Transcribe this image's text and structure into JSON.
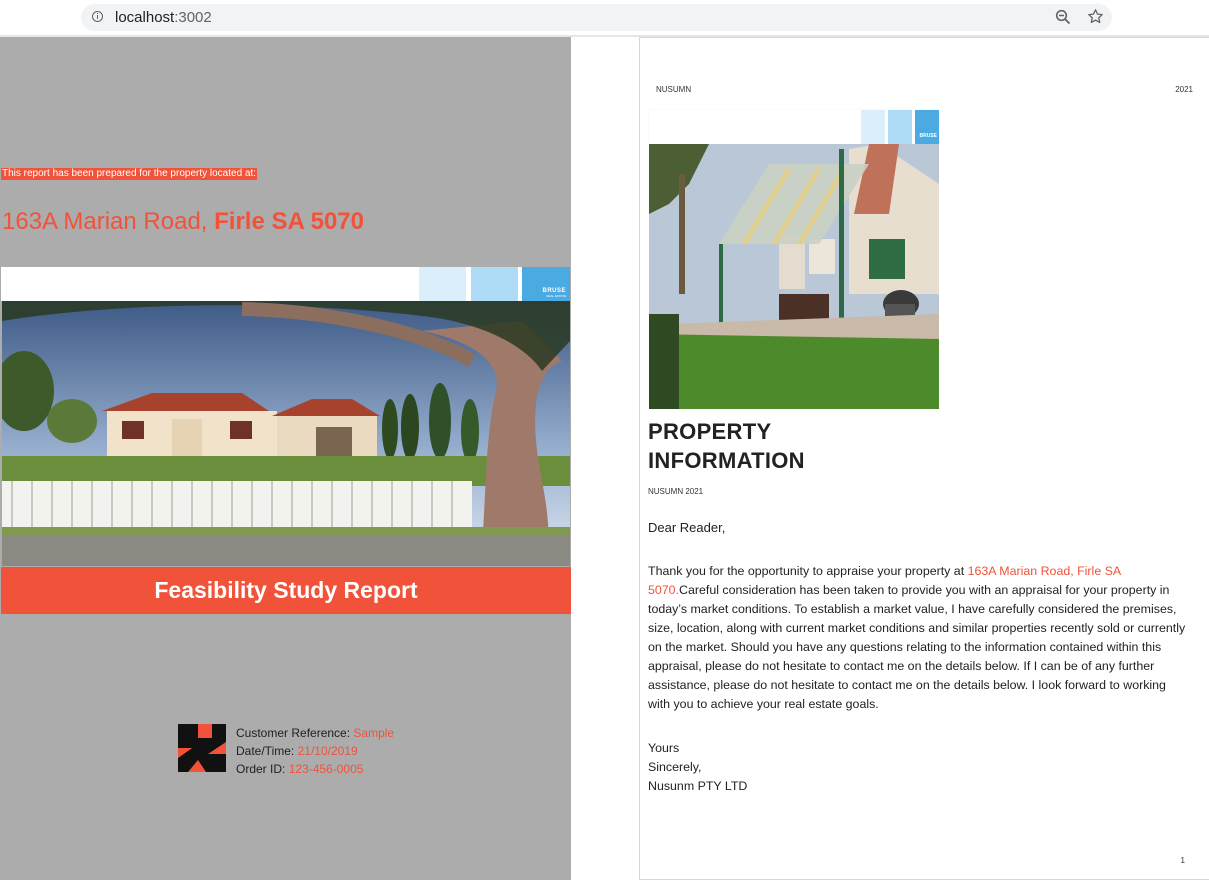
{
  "browser": {
    "url_host": "localhost",
    "url_port": ":3002"
  },
  "cover": {
    "intro": "This report has been prepared for the property located at:",
    "address_street": "163A Marian Road,",
    "address_suburb": "Firle SA 5070",
    "brand_name": "BRUSE",
    "brand_tagline": "REAL ESTATE",
    "title": "Feasibility Study Report",
    "meta": {
      "customer_ref_label": "Customer Reference:",
      "customer_ref_value": "Sample",
      "datetime_label": "Date/Time:",
      "datetime_value": "21/10/2019",
      "order_label": "Order ID:",
      "order_value": "123-456-0005"
    }
  },
  "page": {
    "header_left": "NUSUMN",
    "header_right": "2021",
    "brand_name": "BRUSE",
    "title_line1": "PROPERTY",
    "title_line2": "INFORMATION",
    "subtitle": "NUSUMN 2021",
    "greeting": "Dear Reader,",
    "letter_intro": "Thank you for the opportunity to appraise your property at ",
    "letter_address": "163A Marian Road, Firle SA 5070.",
    "letter_rest": "Careful consideration has been taken to provide you with an appraisal for your property in today’s market conditions. To establish a market value, I have carefully considered the premises, size, location, along with current market conditions and similar properties recently sold or currently on the market. Should you have any questions relating to the information contained within this appraisal, please do not hesitate to contact me on the details below. If I can be of any further assistance, please do not hesitate to contact me on the details below. I look forward to working with you to achieve your real estate goals.",
    "signoff_1": "Yours",
    "signoff_2": "Sincerely,",
    "signoff_3": "Nusunm PTY LTD",
    "page_number": "1"
  },
  "colors": {
    "accent": "#f0533a",
    "cover_bg": "#acacac",
    "brand_blue": "#4caae3"
  }
}
